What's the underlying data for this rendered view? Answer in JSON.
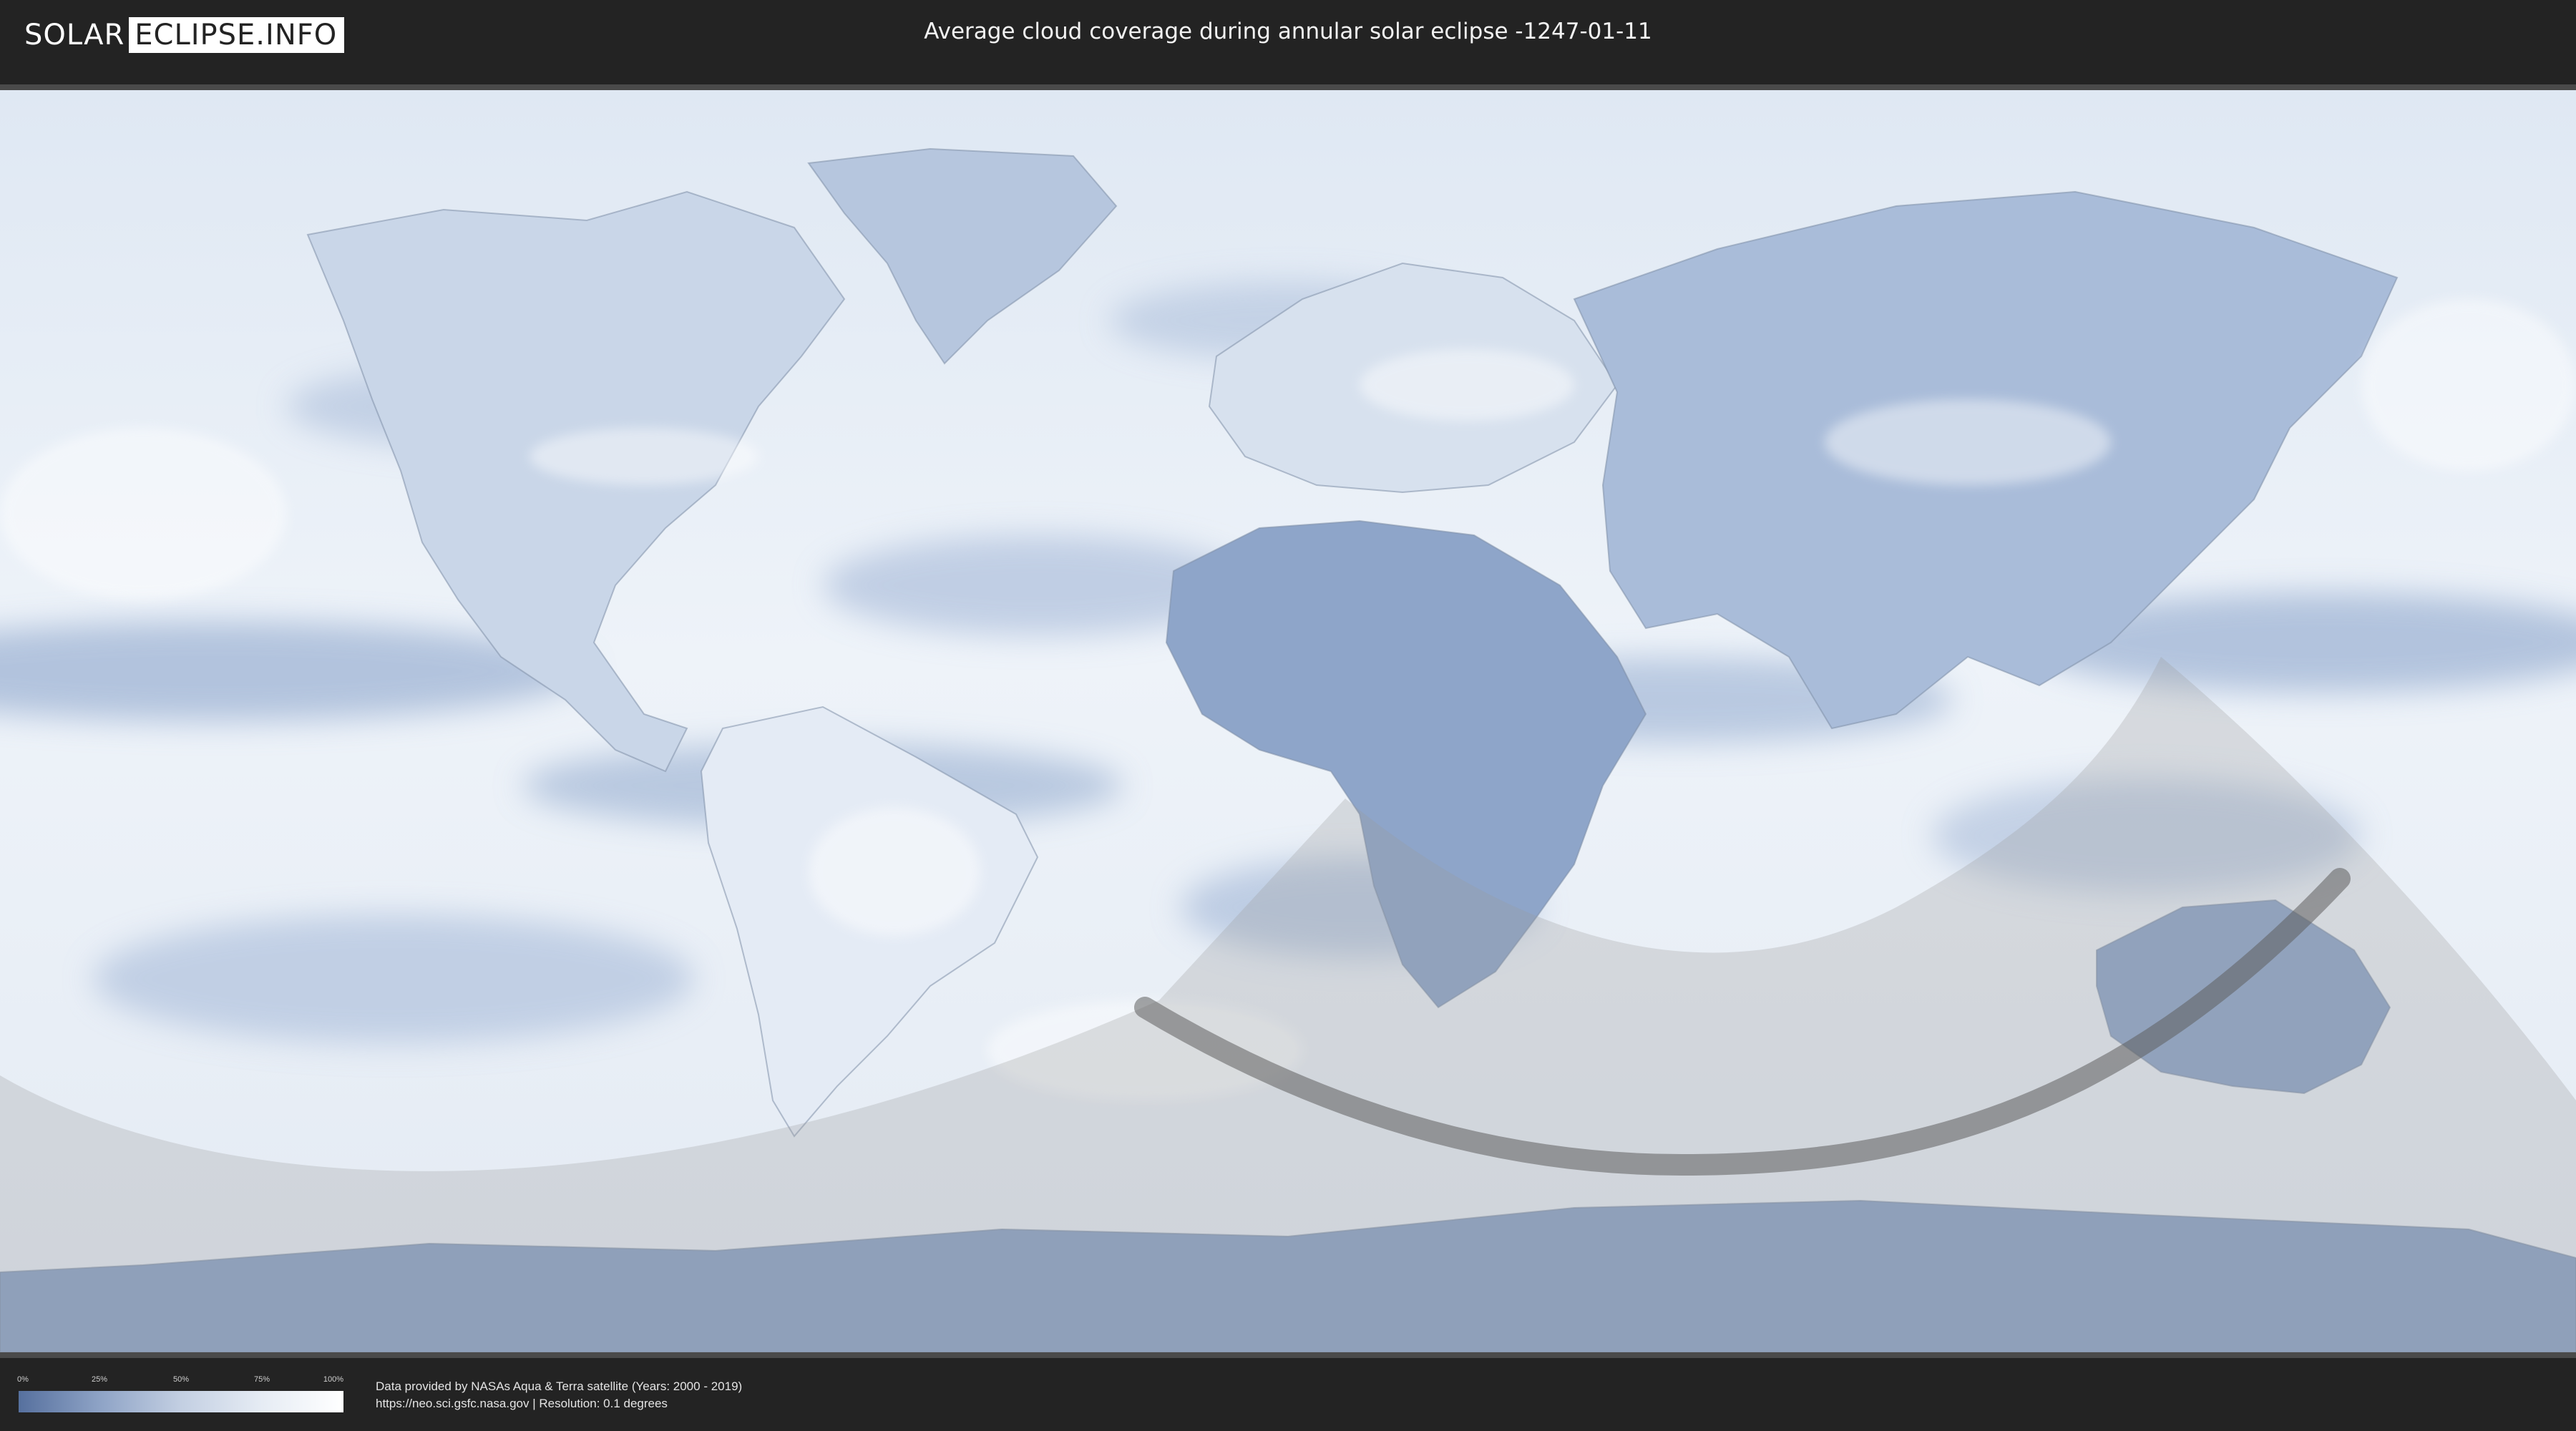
{
  "header": {
    "logo_left": "SOLAR",
    "logo_right": "ECLIPSE.INFO",
    "title": "Average cloud coverage during annular solar eclipse -1247-01-11"
  },
  "map": {
    "description_type": "equirectangular world map of average cloud coverage with eclipse shadow overlay",
    "colors": {
      "ocean_cloud_low": "#8da3c8",
      "cloud_high": "#ffffff",
      "land_dark": "#6a82ae",
      "eclipse_partial_overlay": "#bdbdbd",
      "eclipse_path": "#6e6e6e"
    }
  },
  "legend": {
    "ticks": [
      "0%",
      "25%",
      "50%",
      "75%",
      "100%"
    ],
    "gradient_start": "#56709e",
    "gradient_end": "#ffffff"
  },
  "footer": {
    "credit_line1": "Data provided by NASAs Aqua & Terra satellite (Years: 2000 - 2019)",
    "credit_line2": "https://neo.sci.gsfc.nasa.gov | Resolution: 0.1 degrees"
  }
}
